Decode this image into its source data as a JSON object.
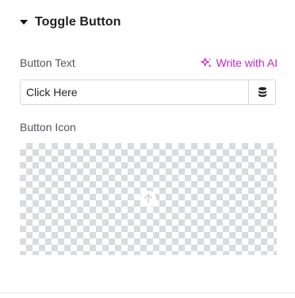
{
  "section": {
    "title": "Toggle Button"
  },
  "fields": {
    "button_text": {
      "label": "Button Text",
      "value": "Click Here"
    },
    "button_icon": {
      "label": "Button Icon"
    }
  },
  "ai": {
    "label": "Write with AI",
    "color": "#c227c6"
  },
  "icons": {
    "caret": "caret-down-icon",
    "sparkle": "sparkle-icon",
    "dynamic": "database-icon",
    "media": "upload-icon"
  }
}
